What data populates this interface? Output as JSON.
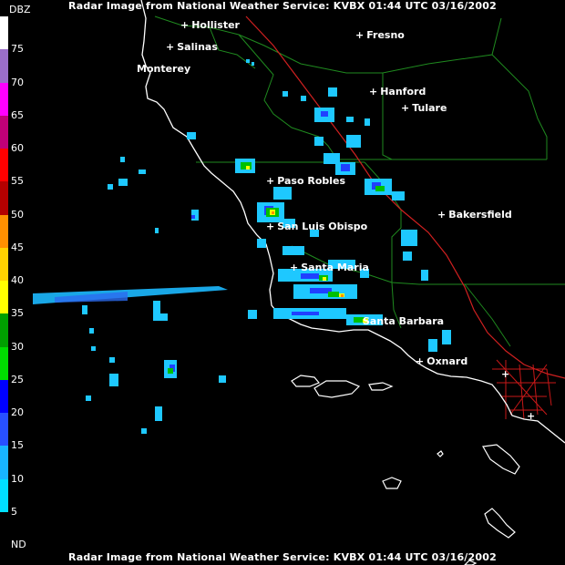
{
  "title": "Radar Image from National Weather Service: KVBX   01:44 UTC  03/16/2002",
  "legend": {
    "unit": "DBZ",
    "labels": [
      "75",
      "70",
      "65",
      "60",
      "55",
      "50",
      "45",
      "40",
      "35",
      "30",
      "25",
      "20",
      "15",
      "10",
      "5",
      "ND"
    ],
    "colors": [
      "#ffffff",
      "#9a6ec8",
      "#ff00ff",
      "#c00078",
      "#ff0000",
      "#b40000",
      "#ff9000",
      "#ffd200",
      "#ffff00",
      "#00a000",
      "#00dc00",
      "#0000ff",
      "#2850ff",
      "#18b4ff",
      "#00e0ff",
      "#000000"
    ]
  },
  "cities": [
    {
      "name": "Hollister",
      "marker": "+"
    },
    {
      "name": "Salinas",
      "marker": "+"
    },
    {
      "name": "Monterey",
      "marker": "+"
    },
    {
      "name": "Fresno",
      "marker": "+"
    },
    {
      "name": "Hanford",
      "marker": "+"
    },
    {
      "name": "Tulare",
      "marker": "+"
    },
    {
      "name": "Paso Robles",
      "marker": "+"
    },
    {
      "name": "San Luis Obispo",
      "marker": "+"
    },
    {
      "name": "Bakersfield",
      "marker": "+"
    },
    {
      "name": "Santa Maria",
      "marker": "+"
    },
    {
      "name": "Santa Barbara",
      "marker": "+"
    },
    {
      "name": "Oxnard",
      "marker": "+"
    }
  ]
}
